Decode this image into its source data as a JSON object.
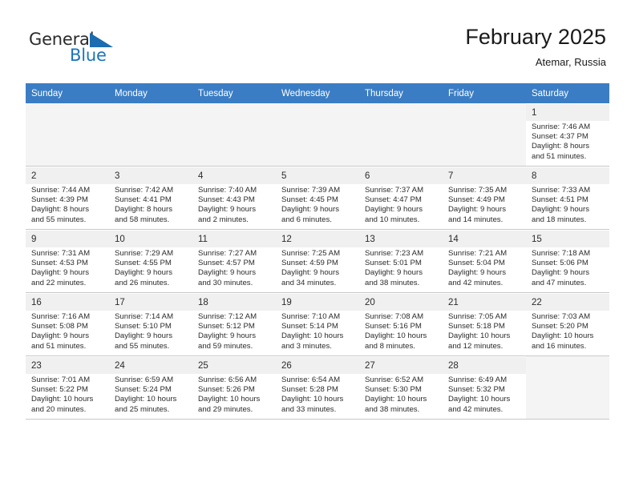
{
  "logo": {
    "word_one": "General",
    "word_two": "Blue",
    "accent_color": "#1b75bb",
    "triangle_icon": "triangle-icon"
  },
  "header": {
    "title": "February 2025",
    "location": "Atemar, Russia"
  },
  "calendar": {
    "weekday_headers": [
      "Sunday",
      "Monday",
      "Tuesday",
      "Wednesday",
      "Thursday",
      "Friday",
      "Saturday"
    ],
    "header_bg": "#3b7dc4",
    "labels": {
      "sunrise": "Sunrise:",
      "sunset": "Sunset:",
      "daylight": "Daylight:"
    },
    "weeks": [
      [
        null,
        null,
        null,
        null,
        null,
        null,
        {
          "day": "1",
          "sunrise": "Sunrise: 7:46 AM",
          "sunset": "Sunset: 4:37 PM",
          "daylight_1": "Daylight: 8 hours",
          "daylight_2": "and 51 minutes."
        }
      ],
      [
        {
          "day": "2",
          "sunrise": "Sunrise: 7:44 AM",
          "sunset": "Sunset: 4:39 PM",
          "daylight_1": "Daylight: 8 hours",
          "daylight_2": "and 55 minutes."
        },
        {
          "day": "3",
          "sunrise": "Sunrise: 7:42 AM",
          "sunset": "Sunset: 4:41 PM",
          "daylight_1": "Daylight: 8 hours",
          "daylight_2": "and 58 minutes."
        },
        {
          "day": "4",
          "sunrise": "Sunrise: 7:40 AM",
          "sunset": "Sunset: 4:43 PM",
          "daylight_1": "Daylight: 9 hours",
          "daylight_2": "and 2 minutes."
        },
        {
          "day": "5",
          "sunrise": "Sunrise: 7:39 AM",
          "sunset": "Sunset: 4:45 PM",
          "daylight_1": "Daylight: 9 hours",
          "daylight_2": "and 6 minutes."
        },
        {
          "day": "6",
          "sunrise": "Sunrise: 7:37 AM",
          "sunset": "Sunset: 4:47 PM",
          "daylight_1": "Daylight: 9 hours",
          "daylight_2": "and 10 minutes."
        },
        {
          "day": "7",
          "sunrise": "Sunrise: 7:35 AM",
          "sunset": "Sunset: 4:49 PM",
          "daylight_1": "Daylight: 9 hours",
          "daylight_2": "and 14 minutes."
        },
        {
          "day": "8",
          "sunrise": "Sunrise: 7:33 AM",
          "sunset": "Sunset: 4:51 PM",
          "daylight_1": "Daylight: 9 hours",
          "daylight_2": "and 18 minutes."
        }
      ],
      [
        {
          "day": "9",
          "sunrise": "Sunrise: 7:31 AM",
          "sunset": "Sunset: 4:53 PM",
          "daylight_1": "Daylight: 9 hours",
          "daylight_2": "and 22 minutes."
        },
        {
          "day": "10",
          "sunrise": "Sunrise: 7:29 AM",
          "sunset": "Sunset: 4:55 PM",
          "daylight_1": "Daylight: 9 hours",
          "daylight_2": "and 26 minutes."
        },
        {
          "day": "11",
          "sunrise": "Sunrise: 7:27 AM",
          "sunset": "Sunset: 4:57 PM",
          "daylight_1": "Daylight: 9 hours",
          "daylight_2": "and 30 minutes."
        },
        {
          "day": "12",
          "sunrise": "Sunrise: 7:25 AM",
          "sunset": "Sunset: 4:59 PM",
          "daylight_1": "Daylight: 9 hours",
          "daylight_2": "and 34 minutes."
        },
        {
          "day": "13",
          "sunrise": "Sunrise: 7:23 AM",
          "sunset": "Sunset: 5:01 PM",
          "daylight_1": "Daylight: 9 hours",
          "daylight_2": "and 38 minutes."
        },
        {
          "day": "14",
          "sunrise": "Sunrise: 7:21 AM",
          "sunset": "Sunset: 5:04 PM",
          "daylight_1": "Daylight: 9 hours",
          "daylight_2": "and 42 minutes."
        },
        {
          "day": "15",
          "sunrise": "Sunrise: 7:18 AM",
          "sunset": "Sunset: 5:06 PM",
          "daylight_1": "Daylight: 9 hours",
          "daylight_2": "and 47 minutes."
        }
      ],
      [
        {
          "day": "16",
          "sunrise": "Sunrise: 7:16 AM",
          "sunset": "Sunset: 5:08 PM",
          "daylight_1": "Daylight: 9 hours",
          "daylight_2": "and 51 minutes."
        },
        {
          "day": "17",
          "sunrise": "Sunrise: 7:14 AM",
          "sunset": "Sunset: 5:10 PM",
          "daylight_1": "Daylight: 9 hours",
          "daylight_2": "and 55 minutes."
        },
        {
          "day": "18",
          "sunrise": "Sunrise: 7:12 AM",
          "sunset": "Sunset: 5:12 PM",
          "daylight_1": "Daylight: 9 hours",
          "daylight_2": "and 59 minutes."
        },
        {
          "day": "19",
          "sunrise": "Sunrise: 7:10 AM",
          "sunset": "Sunset: 5:14 PM",
          "daylight_1": "Daylight: 10 hours",
          "daylight_2": "and 3 minutes."
        },
        {
          "day": "20",
          "sunrise": "Sunrise: 7:08 AM",
          "sunset": "Sunset: 5:16 PM",
          "daylight_1": "Daylight: 10 hours",
          "daylight_2": "and 8 minutes."
        },
        {
          "day": "21",
          "sunrise": "Sunrise: 7:05 AM",
          "sunset": "Sunset: 5:18 PM",
          "daylight_1": "Daylight: 10 hours",
          "daylight_2": "and 12 minutes."
        },
        {
          "day": "22",
          "sunrise": "Sunrise: 7:03 AM",
          "sunset": "Sunset: 5:20 PM",
          "daylight_1": "Daylight: 10 hours",
          "daylight_2": "and 16 minutes."
        }
      ],
      [
        {
          "day": "23",
          "sunrise": "Sunrise: 7:01 AM",
          "sunset": "Sunset: 5:22 PM",
          "daylight_1": "Daylight: 10 hours",
          "daylight_2": "and 20 minutes."
        },
        {
          "day": "24",
          "sunrise": "Sunrise: 6:59 AM",
          "sunset": "Sunset: 5:24 PM",
          "daylight_1": "Daylight: 10 hours",
          "daylight_2": "and 25 minutes."
        },
        {
          "day": "25",
          "sunrise": "Sunrise: 6:56 AM",
          "sunset": "Sunset: 5:26 PM",
          "daylight_1": "Daylight: 10 hours",
          "daylight_2": "and 29 minutes."
        },
        {
          "day": "26",
          "sunrise": "Sunrise: 6:54 AM",
          "sunset": "Sunset: 5:28 PM",
          "daylight_1": "Daylight: 10 hours",
          "daylight_2": "and 33 minutes."
        },
        {
          "day": "27",
          "sunrise": "Sunrise: 6:52 AM",
          "sunset": "Sunset: 5:30 PM",
          "daylight_1": "Daylight: 10 hours",
          "daylight_2": "and 38 minutes."
        },
        {
          "day": "28",
          "sunrise": "Sunrise: 6:49 AM",
          "sunset": "Sunset: 5:32 PM",
          "daylight_1": "Daylight: 10 hours",
          "daylight_2": "and 42 minutes."
        },
        null
      ]
    ]
  }
}
